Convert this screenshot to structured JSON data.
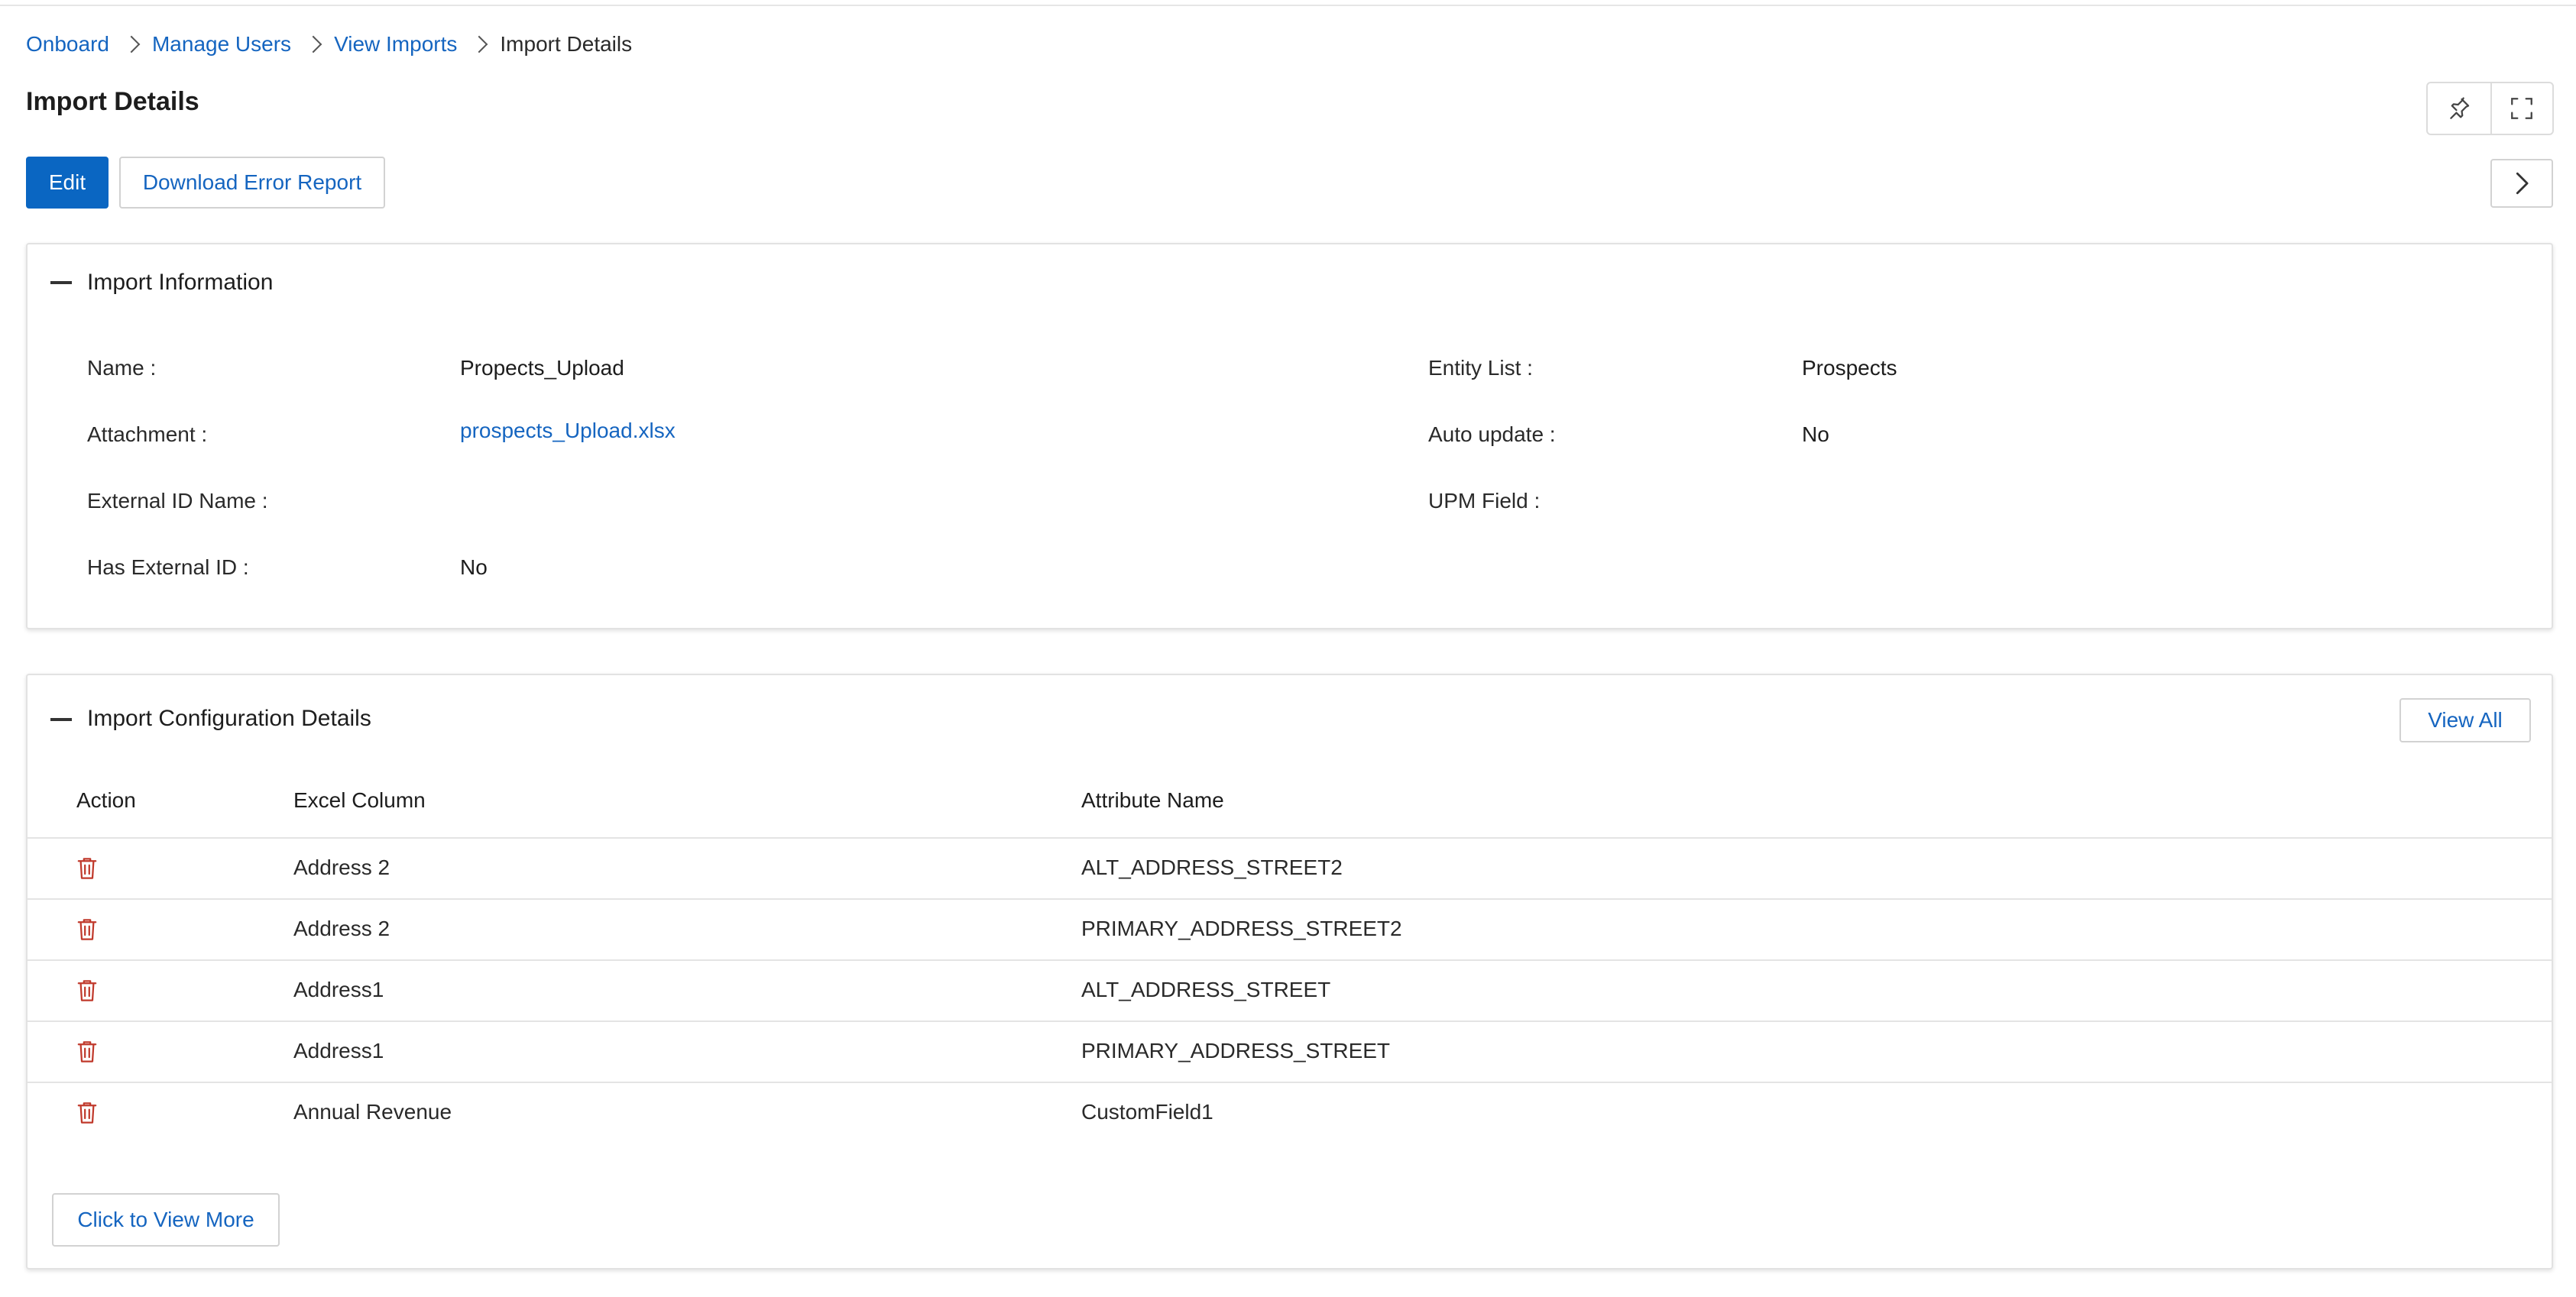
{
  "breadcrumb": {
    "items": [
      "Onboard",
      "Manage Users",
      "View Imports"
    ],
    "current": "Import Details"
  },
  "page": {
    "title": "Import Details"
  },
  "toolbar": {
    "edit_label": "Edit",
    "download_label": "Download Error Report"
  },
  "import_info": {
    "title": "Import Information",
    "name_label": "Name :",
    "name_value": "Propects_Upload",
    "attachment_label": "Attachment :",
    "attachment_value": "prospects_Upload.xlsx",
    "external_id_name_label": "External ID Name :",
    "external_id_name_value": "",
    "has_external_id_label": "Has External ID :",
    "has_external_id_value": "No",
    "entity_list_label": "Entity List :",
    "entity_list_value": "Prospects",
    "auto_update_label": "Auto update :",
    "auto_update_value": "No",
    "upm_field_label": "UPM Field :",
    "upm_field_value": ""
  },
  "config": {
    "title": "Import Configuration Details",
    "view_all_label": "View All",
    "columns": [
      "Action",
      "Excel Column",
      "Attribute Name"
    ],
    "rows": [
      {
        "excel_column": "Address 2",
        "attribute_name": "ALT_ADDRESS_STREET2"
      },
      {
        "excel_column": "Address 2",
        "attribute_name": "PRIMARY_ADDRESS_STREET2"
      },
      {
        "excel_column": "Address1",
        "attribute_name": "ALT_ADDRESS_STREET"
      },
      {
        "excel_column": "Address1",
        "attribute_name": "PRIMARY_ADDRESS_STREET"
      },
      {
        "excel_column": "Annual Revenue",
        "attribute_name": "CustomField1"
      }
    ],
    "view_more_label": "Click to View More"
  },
  "icons": {
    "pin": "pin-icon",
    "fullscreen": "fullscreen-icon",
    "next": "chevron-right-icon",
    "collapse": "minus-icon",
    "delete": "trash-icon"
  },
  "colors": {
    "primary": "#0a66c2",
    "link": "#1565c0",
    "delete": "#c0392b"
  }
}
